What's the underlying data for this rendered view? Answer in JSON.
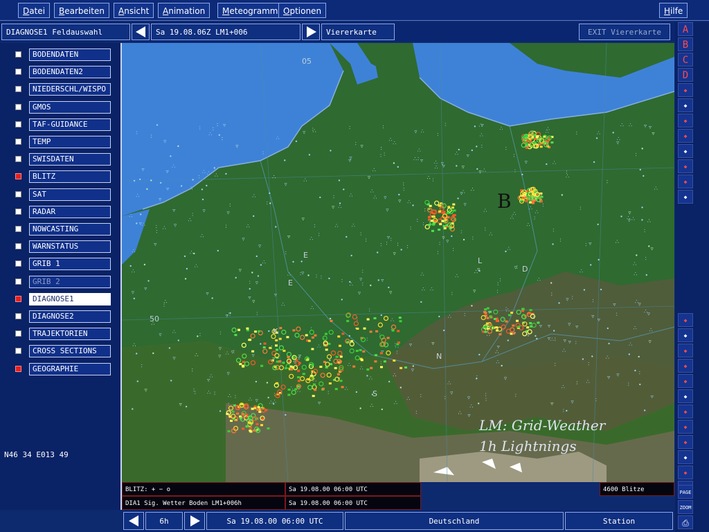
{
  "menu": [
    "Datei",
    "Bearbeiten",
    "Ansicht",
    "Animation",
    "Meteogramme",
    "Optionen"
  ],
  "menu_help": "Hilfe",
  "toolbar": {
    "feld_label": "DIAGNOSE1 Feldauswahl",
    "date_label": "Sa 19.08.06Z LM1+006",
    "vierer_label": "Viererkarte",
    "exit_label": "EXIT Viererkarte"
  },
  "sidebar": {
    "items": [
      {
        "label": "BODENDATEN",
        "checked": false,
        "state": "normal"
      },
      {
        "label": "BODENDATEN2",
        "checked": false,
        "state": "normal"
      },
      {
        "label": "NIEDERSCHL/WISPO",
        "checked": false,
        "state": "normal"
      },
      {
        "label": "GMOS",
        "checked": false,
        "state": "normal"
      },
      {
        "label": "TAF-GUIDANCE",
        "checked": false,
        "state": "normal"
      },
      {
        "label": "TEMP",
        "checked": false,
        "state": "normal"
      },
      {
        "label": "SWISDATEN",
        "checked": false,
        "state": "normal"
      },
      {
        "label": "BLITZ",
        "checked": true,
        "state": "normal"
      },
      {
        "label": "SAT",
        "checked": false,
        "state": "normal"
      },
      {
        "label": "RADAR",
        "checked": false,
        "state": "normal"
      },
      {
        "label": "NOWCASTING",
        "checked": false,
        "state": "normal"
      },
      {
        "label": "WARNSTATUS",
        "checked": false,
        "state": "normal"
      },
      {
        "label": "GRIB 1",
        "checked": false,
        "state": "normal"
      },
      {
        "label": "GRIB 2",
        "checked": false,
        "state": "disabled"
      },
      {
        "label": "DIAGNOSE1",
        "checked": true,
        "state": "active"
      },
      {
        "label": "DIAGNOSE2",
        "checked": false,
        "state": "normal"
      },
      {
        "label": "TRAJEKTORIEN",
        "checked": false,
        "state": "normal"
      },
      {
        "label": "CROSS SECTIONS",
        "checked": false,
        "state": "normal"
      },
      {
        "label": "GEOGRAPHIE",
        "checked": true,
        "state": "normal"
      }
    ],
    "coords": "N46 34 E013 49"
  },
  "map": {
    "pressure_label": "B",
    "title_line1": "LM: Grid-Weather",
    "title_line2": "1h Lightnings",
    "lat_label": "50",
    "lon_label": "05",
    "country_letters": [
      "E",
      "L",
      "D",
      "N",
      "S",
      "E",
      "K"
    ]
  },
  "info": {
    "row1_left": "BLITZ: + − o",
    "row1_right": "Sa 19.08.00 06:00 UTC",
    "row2_left": "DIA1 Sig. Wetter Boden LM1+006h",
    "row2_right": "Sa 19.08.00 06:00 UTC",
    "count": "4600 Blitze"
  },
  "bottombar": {
    "step": "6h",
    "datetime": "Sa 19.08.00 06:00 UTC",
    "region": "Deutschland",
    "station": "Station"
  },
  "rightcol": {
    "letters": [
      "A",
      "B",
      "C",
      "D"
    ],
    "labels": [
      "PAGE",
      "ZOOM"
    ]
  },
  "colors": {
    "background": "#0e2a6e",
    "button_border": "#8ea8e8",
    "checkbox_on": "#e8201e",
    "sea": "#3e82d8",
    "land": "#2f6a30"
  }
}
